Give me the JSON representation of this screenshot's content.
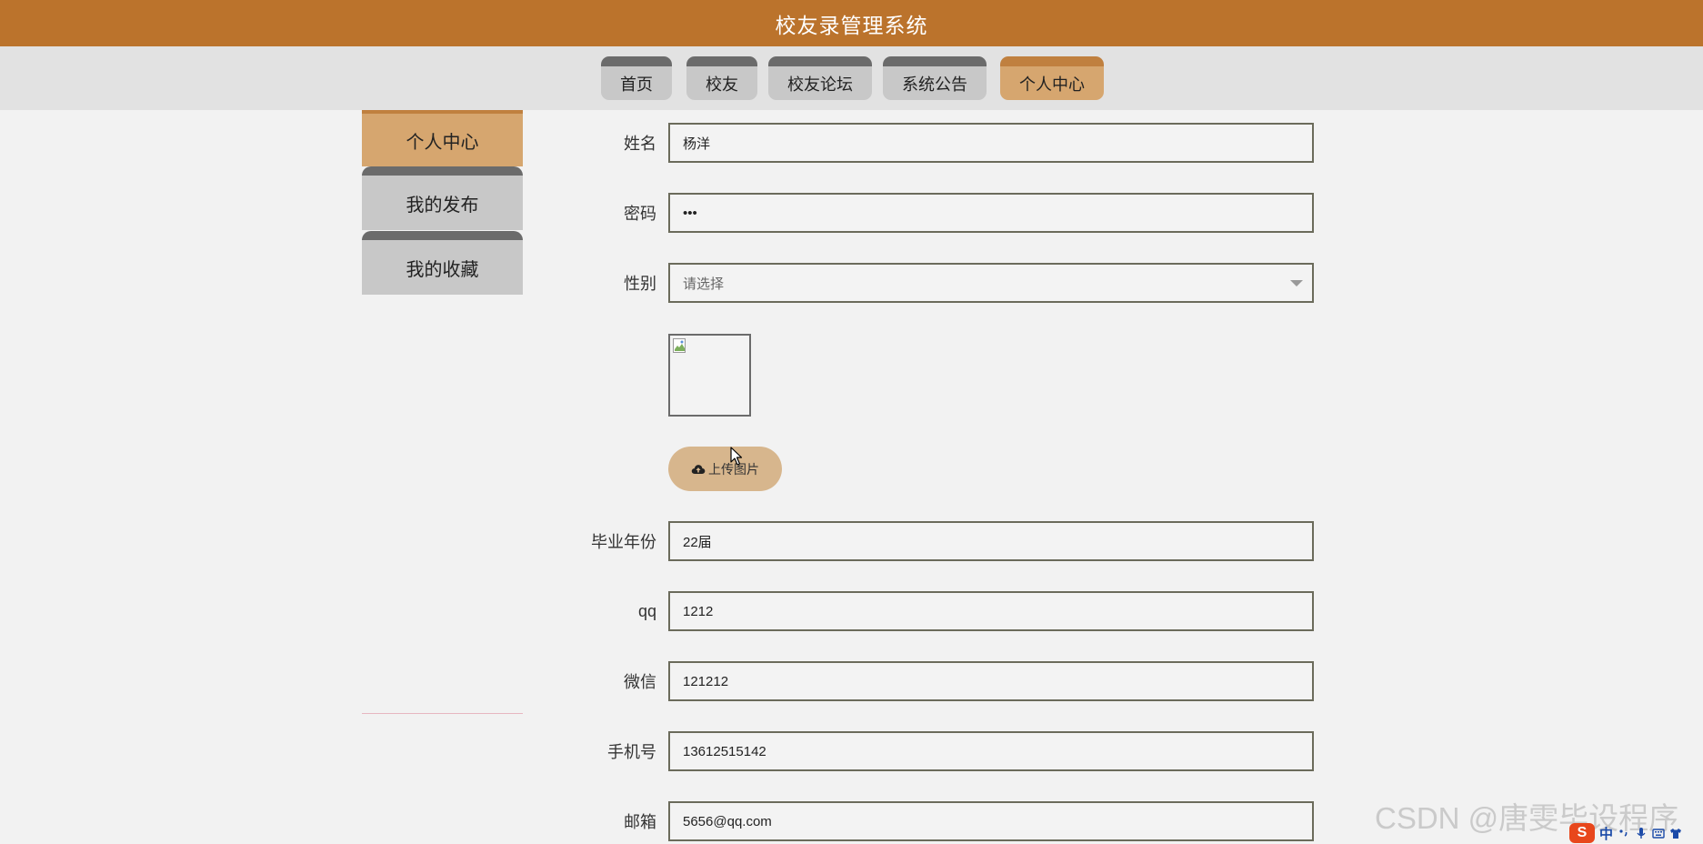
{
  "header": {
    "title": "校友录管理系统"
  },
  "nav": {
    "tabs": [
      {
        "label": "首页"
      },
      {
        "label": "校友"
      },
      {
        "label": "校友论坛"
      },
      {
        "label": "系统公告"
      },
      {
        "label": "个人中心"
      }
    ],
    "active": "个人中心"
  },
  "sidebar": {
    "items": [
      {
        "label": "个人中心"
      },
      {
        "label": "我的发布"
      },
      {
        "label": "我的收藏"
      }
    ]
  },
  "form": {
    "name": {
      "label": "姓名",
      "value": "杨洋"
    },
    "password": {
      "label": "密码",
      "value": "•••"
    },
    "gender": {
      "label": "性别",
      "placeholder": "请选择"
    },
    "upload_label": "上传图片",
    "grad_year": {
      "label": "毕业年份",
      "value": "22届"
    },
    "qq": {
      "label": "qq",
      "value": "1212"
    },
    "wechat": {
      "label": "微信",
      "value": "121212"
    },
    "phone": {
      "label": "手机号",
      "value": "13612515142"
    },
    "email": {
      "label": "邮箱",
      "value": "5656@qq.com"
    }
  },
  "watermark": "CSDN @唐雯毕设程序",
  "ime": {
    "logo": "S",
    "mode": "中"
  },
  "colors": {
    "header": "#bb732c",
    "active_tab": "#d6a66f",
    "tab": "#c8c8c8",
    "tab_top": "#6b6b6b",
    "upload_button": "#d7b68d"
  }
}
